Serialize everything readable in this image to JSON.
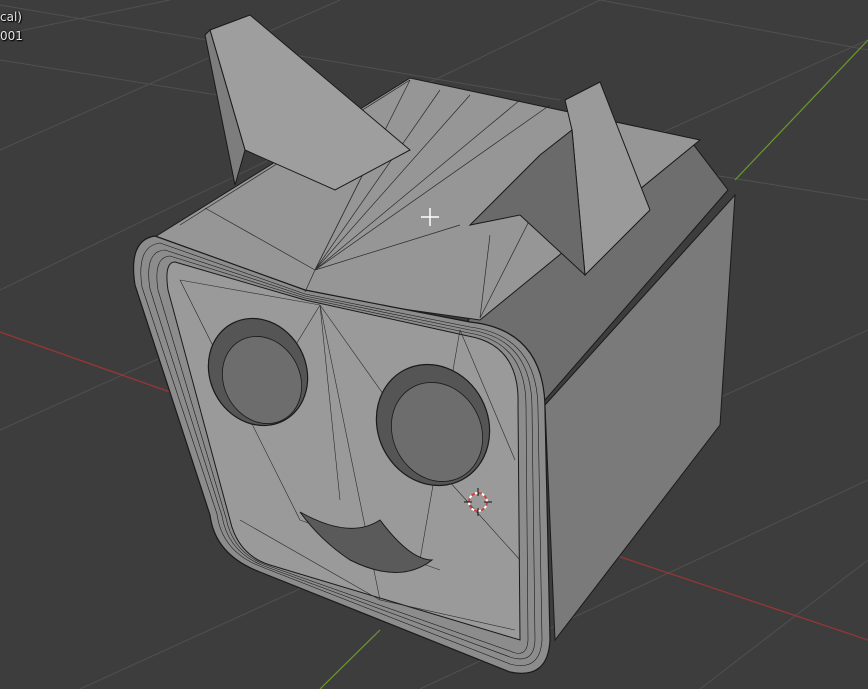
{
  "viewport": {
    "overlay_line_1": "cal)",
    "overlay_line_2": "001"
  },
  "colors": {
    "background": "#3d3d3d",
    "grid_line": "#505050",
    "x_axis": "#9b3535",
    "y_axis": "#6b9a2a",
    "mesh_face": "#8c8c8c",
    "wire": "#1a1a1a",
    "cursor_outer": "#cc4444",
    "cursor_inner": "#ffffff"
  },
  "icons": {
    "cursor_3d": "3d-cursor-icon",
    "crosshair": "crosshair-icon"
  }
}
